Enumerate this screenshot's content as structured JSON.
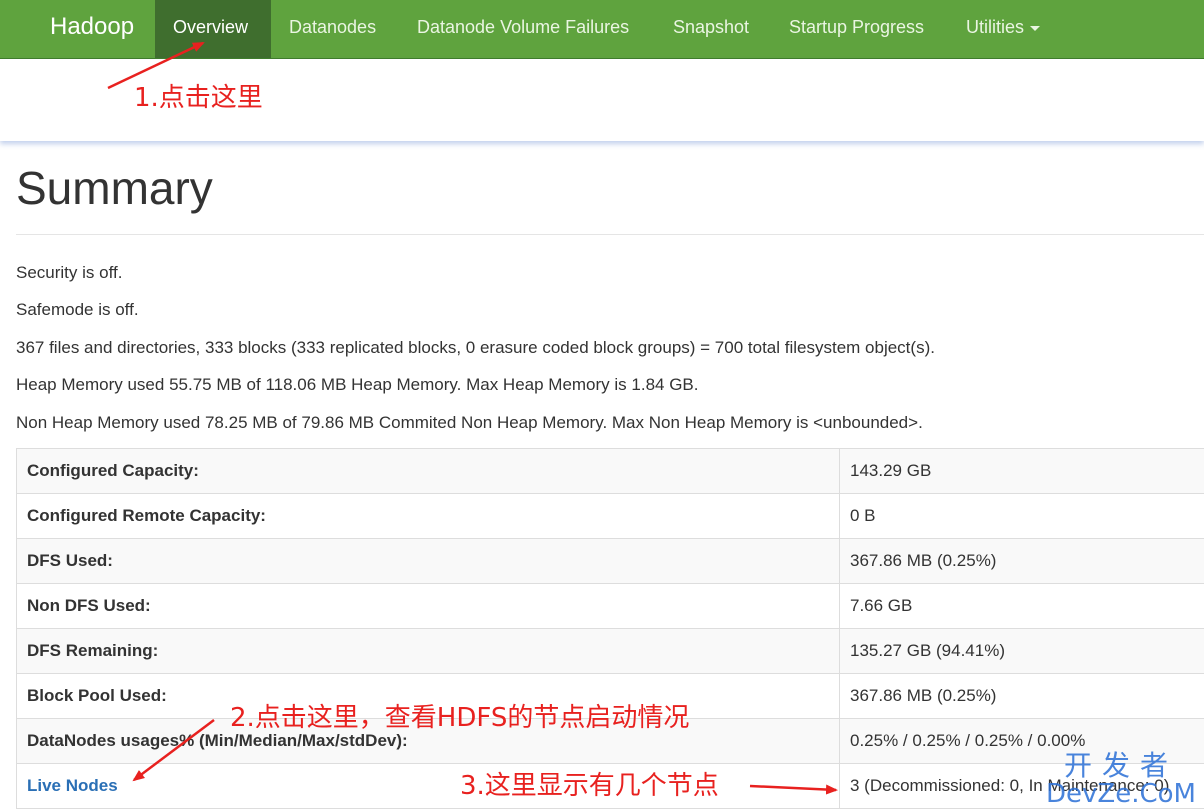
{
  "navbar": {
    "brand": "Hadoop",
    "items": [
      {
        "label": "Overview",
        "active": true
      },
      {
        "label": "Datanodes",
        "active": false
      },
      {
        "label": "Datanode Volume Failures",
        "active": false
      },
      {
        "label": "Snapshot",
        "active": false
      },
      {
        "label": "Startup Progress",
        "active": false
      },
      {
        "label": "Utilities",
        "active": false
      }
    ]
  },
  "page": {
    "title": "Summary",
    "info": [
      "Security is off.",
      "Safemode is off.",
      "367 files and directories, 333 blocks (333 replicated blocks, 0 erasure coded block groups) = 700 total filesystem object(s).",
      "Heap Memory used 55.75 MB of 118.06 MB Heap Memory. Max Heap Memory is 1.84 GB.",
      "Non Heap Memory used 78.25 MB of 79.86 MB Commited Non Heap Memory. Max Non Heap Memory is <unbounded>."
    ]
  },
  "summary_table": [
    {
      "key": "Configured Capacity:",
      "value": "143.29 GB"
    },
    {
      "key": "Configured Remote Capacity:",
      "value": "0 B"
    },
    {
      "key": "DFS Used:",
      "value": "367.86 MB (0.25%)"
    },
    {
      "key": "Non DFS Used:",
      "value": "7.66 GB"
    },
    {
      "key": "DFS Remaining:",
      "value": "135.27 GB (94.41%)"
    },
    {
      "key": "Block Pool Used:",
      "value": "367.86 MB (0.25%)"
    },
    {
      "key": "DataNodes usages% (Min/Median/Max/stdDev):",
      "value": "0.25% / 0.25% / 0.25% / 0.00%"
    },
    {
      "key": "Live Nodes",
      "value": "3 (Decommissioned: 0, In Maintenance: 0)"
    }
  ],
  "annotations": {
    "step1": "1.点击这里",
    "step2": "2.点击这里，查看HDFS的节点启动情况",
    "step3": "3.这里显示有几个节点"
  },
  "watermark": {
    "top": "开发者",
    "bottom": "DevZe.CoM"
  },
  "colors": {
    "navbar": "#5fa33e",
    "navbar_active": "#3f6e2e",
    "link": "#2a6fb5",
    "annotation": "#e8211f",
    "watermark": "#2a6fd6"
  }
}
